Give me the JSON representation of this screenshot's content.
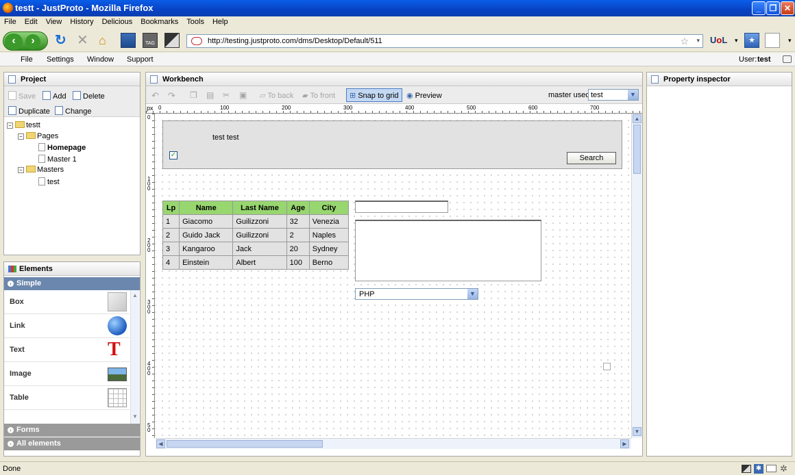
{
  "window": {
    "title": "testt - JustProto - Mozilla Firefox"
  },
  "menu": [
    "File",
    "Edit",
    "View",
    "History",
    "Delicious",
    "Bookmarks",
    "Tools",
    "Help"
  ],
  "nav": {
    "url": "http://testing.justproto.com/dms/Desktop/Default/511"
  },
  "appmenu": {
    "items": [
      "File",
      "Settings",
      "Window",
      "Support"
    ],
    "user_label": "User:",
    "user_name": "test"
  },
  "project": {
    "title": "Project",
    "buttons": [
      "Save",
      "Add",
      "Delete",
      "Duplicate",
      "Change"
    ],
    "tree": {
      "root": "testt",
      "pages": "Pages",
      "homepage": "Homepage",
      "master1": "Master 1",
      "masters": "Masters",
      "test": "test"
    }
  },
  "elements": {
    "title": "Elements",
    "sections": [
      "Simple",
      "Forms",
      "All elements"
    ],
    "items": [
      "Box",
      "Link",
      "Text",
      "Image",
      "Table"
    ]
  },
  "workbench": {
    "title": "Workbench",
    "toolbar": {
      "to_back": "To back",
      "to_front": "To front",
      "snap": "Snap to grid",
      "preview": "Preview",
      "master_label": "master used:",
      "master_value": "test"
    },
    "ruler": {
      "unit": "px",
      "h": [
        "0",
        "100",
        "200",
        "300",
        "400",
        "500",
        "600",
        "700"
      ],
      "v": [
        "0",
        "1 0 0",
        "2 0 0",
        "3 0 0",
        "4 0 0",
        "5 0"
      ]
    },
    "header_text": "test test",
    "search_button": "Search",
    "table": {
      "headers": [
        "Lp",
        "Name",
        "Last Name",
        "Age",
        "City"
      ],
      "rows": [
        [
          "1",
          "Giacomo",
          "Guilizzoni",
          "32",
          "Venezia"
        ],
        [
          "2",
          "Guido Jack",
          "Guilizzoni",
          "2",
          "Naples"
        ],
        [
          "3",
          "Kangaroo",
          "Jack",
          "20",
          "Sydney"
        ],
        [
          "4",
          "Einstein",
          "Albert",
          "100",
          "Berno"
        ]
      ]
    },
    "select_value": "PHP"
  },
  "inspector": {
    "title": "Property inspector"
  },
  "status": "Done",
  "colors": {
    "title_bar": "#0a4fd6",
    "table_header": "#98d670",
    "accordion": "#6b87ad",
    "accordion_inactive": "#9a9a9a"
  }
}
